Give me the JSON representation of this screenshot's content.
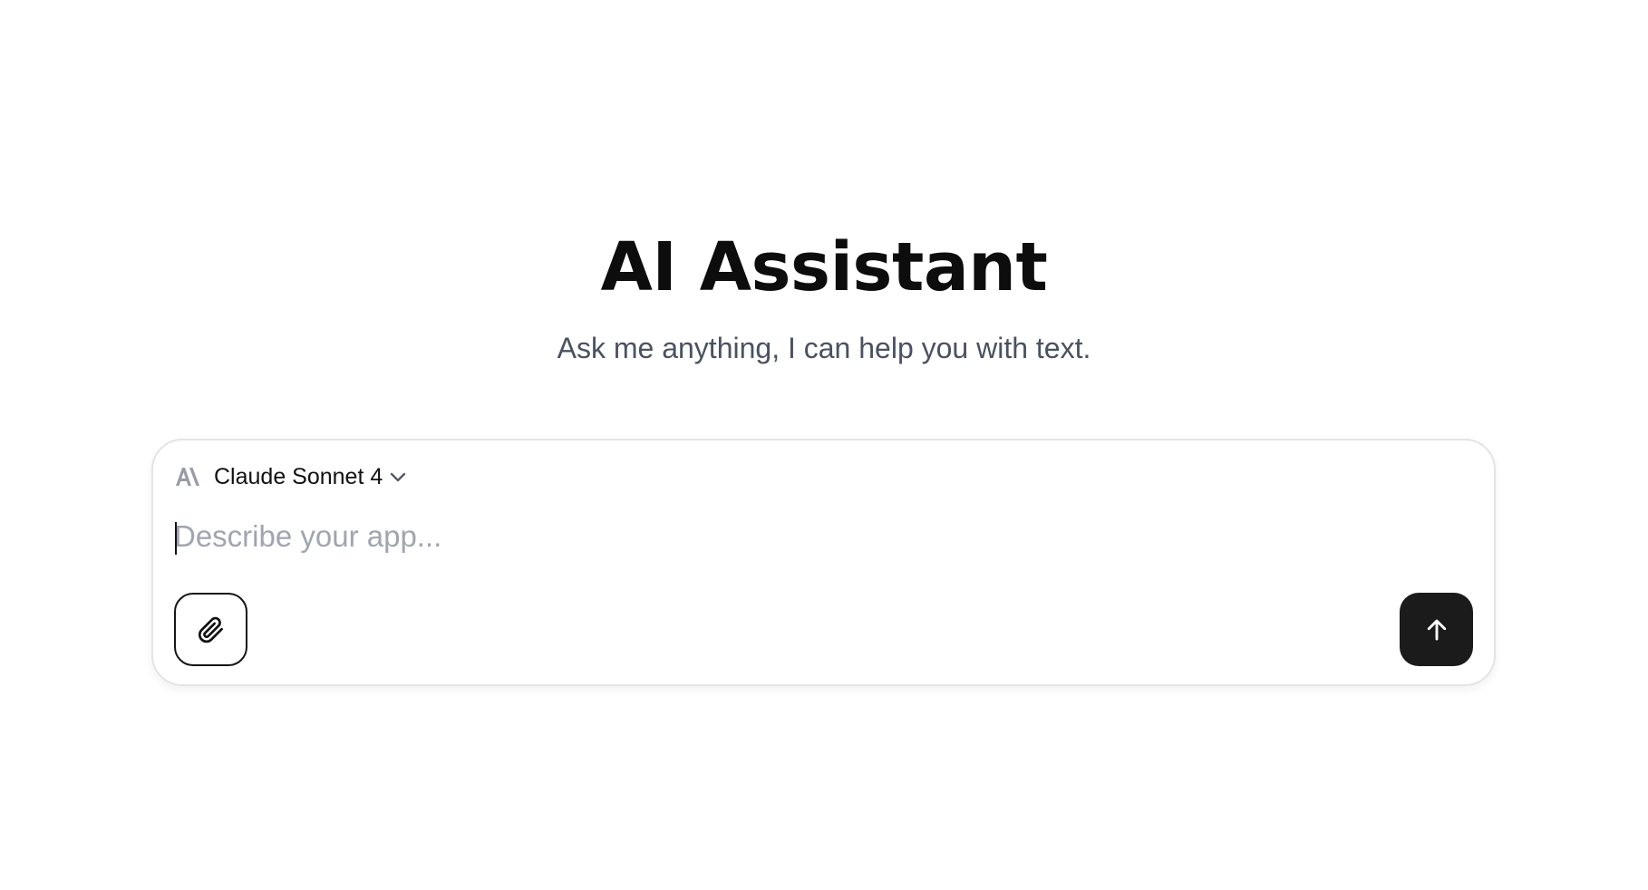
{
  "header": {
    "title": "AI Assistant",
    "subtitle": "Ask me anything, I can help you with text."
  },
  "composer": {
    "model": {
      "name": "Claude Sonnet 4",
      "logo_icon": "anthropic-logo-icon",
      "dropdown_icon": "chevron-down-icon"
    },
    "input": {
      "value": "",
      "placeholder": "Describe your app..."
    },
    "attach_icon": "paperclip-icon",
    "send_icon": "arrow-up-icon"
  },
  "colors": {
    "page_background": "#ffffff",
    "title": "#0d0d0d",
    "subtitle": "#4b5160",
    "placeholder": "#a1a5b0",
    "composer_border": "#e3e4e8",
    "send_button": "#1b1b1b",
    "model_logo": "#9a9ca5"
  }
}
